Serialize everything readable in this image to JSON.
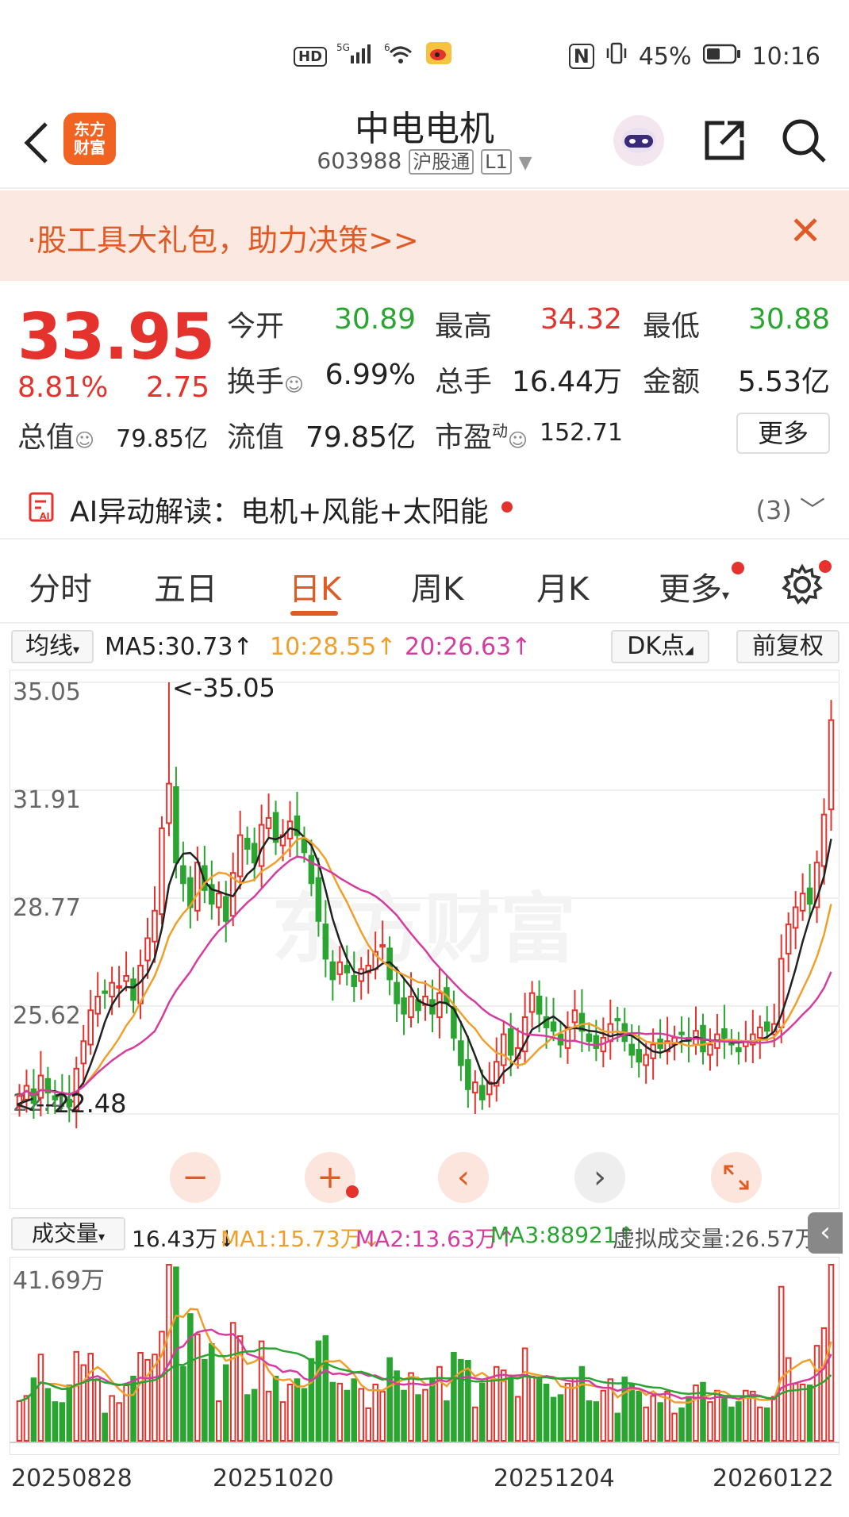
{
  "status": {
    "icons_left": [
      "HD",
      "5G",
      "6"
    ],
    "nfc": "N",
    "battery": "45%",
    "time": "10:16"
  },
  "header": {
    "name": "中电电机",
    "code": "603988",
    "tag1": "沪股通",
    "tag2": "L1",
    "logo": [
      "东方",
      "财富"
    ]
  },
  "banner": {
    "text": "·股工具大礼包，助力决策>>"
  },
  "quote": {
    "price": "33.95",
    "pct": "8.81%",
    "change": "2.75",
    "open_label": "今开",
    "open": "30.89",
    "high_label": "最高",
    "high": "34.32",
    "low_label": "最低",
    "low": "30.88",
    "turnover_label": "换手",
    "turnover": "6.99%",
    "volume_label": "总手",
    "volume": "16.44万",
    "amount_label": "金额",
    "amount": "5.53亿",
    "cap_label": "总值",
    "cap": "79.85亿",
    "float_label": "流值",
    "float": "79.85亿",
    "pe_label": "市盈",
    "pe_sup": "动",
    "pe": "152.71",
    "more": "更多"
  },
  "ai": {
    "text": "AI异动解读：电机+风能+太阳能",
    "count": "(3)"
  },
  "tabs": [
    "分时",
    "五日",
    "日K",
    "周K",
    "月K",
    "更多"
  ],
  "ma": {
    "select": "均线",
    "ma5": "MA5:30.73↑",
    "ma10": "10:28.55↑",
    "ma20": "20:26.63↑",
    "dk": "DK点",
    "adj": "前复权"
  },
  "chart_data": {
    "type": "candlestick",
    "ylabels": [
      "35.05",
      "31.91",
      "28.77",
      "25.62",
      "22.48"
    ],
    "ylim": [
      22.48,
      35.05
    ],
    "high_marker": "<-35.05",
    "low_marker": "<--22.48",
    "watermark": "东方财富",
    "colors": {
      "up": "#e5322d",
      "down": "#2aa531",
      "ma5": "#222222",
      "ma10": "#f0a02a",
      "ma20": "#d63ca0"
    },
    "close": [
      23.0,
      23.3,
      22.8,
      23.6,
      23.1,
      22.9,
      23.0,
      22.7,
      23.8,
      24.6,
      25.5,
      25.9,
      26.0,
      26.3,
      26.2,
      26.5,
      25.8,
      26.8,
      27.6,
      28.4,
      30.8,
      32.1,
      29.8,
      29.2,
      28.5,
      29.8,
      29.0,
      28.6,
      28.9,
      28.1,
      29.5,
      30.6,
      30.2,
      29.8,
      30.9,
      31.1,
      30.4,
      30.6,
      31.0,
      30.6,
      30.1,
      29.2,
      28.1,
      27.0,
      26.4,
      26.9,
      26.6,
      26.2,
      26.7,
      26.8,
      27.2,
      27.4,
      26.4,
      25.7,
      25.4,
      25.9,
      25.5,
      25.9,
      25.4,
      26.0,
      25.7,
      24.7,
      23.9,
      23.2,
      23.4,
      22.9,
      23.4,
      24.0,
      24.8,
      24.2,
      24.4,
      25.3,
      26.0,
      25.4,
      25.0,
      24.9,
      24.5,
      25.0,
      25.5,
      24.9,
      24.6,
      24.4,
      24.7,
      25.1,
      25.2,
      24.6,
      24.2,
      24.0,
      24.2,
      24.5,
      24.4,
      24.6,
      24.7,
      24.8,
      24.6,
      24.9,
      24.3,
      24.5,
      24.8,
      24.7,
      24.5,
      24.3,
      24.6,
      24.8,
      25.0,
      24.9,
      25.1,
      27.0,
      28.0,
      28.5,
      28.9,
      28.6,
      29.8,
      31.2,
      33.95
    ],
    "volume_values": {
      "labels": [
        "41.69万"
      ]
    }
  },
  "vol": {
    "select": "成交量",
    "v": "16.43万↓",
    "ma1": "MA1:15.73万↓",
    "ma2": "MA2:13.63万↑",
    "ma3": "MA3:88921↑",
    "virtual": "虚拟成交量:26.57万",
    "ymax": "41.69万"
  },
  "dates": [
    "20250828",
    "20251020",
    "20251204",
    "20260122"
  ]
}
